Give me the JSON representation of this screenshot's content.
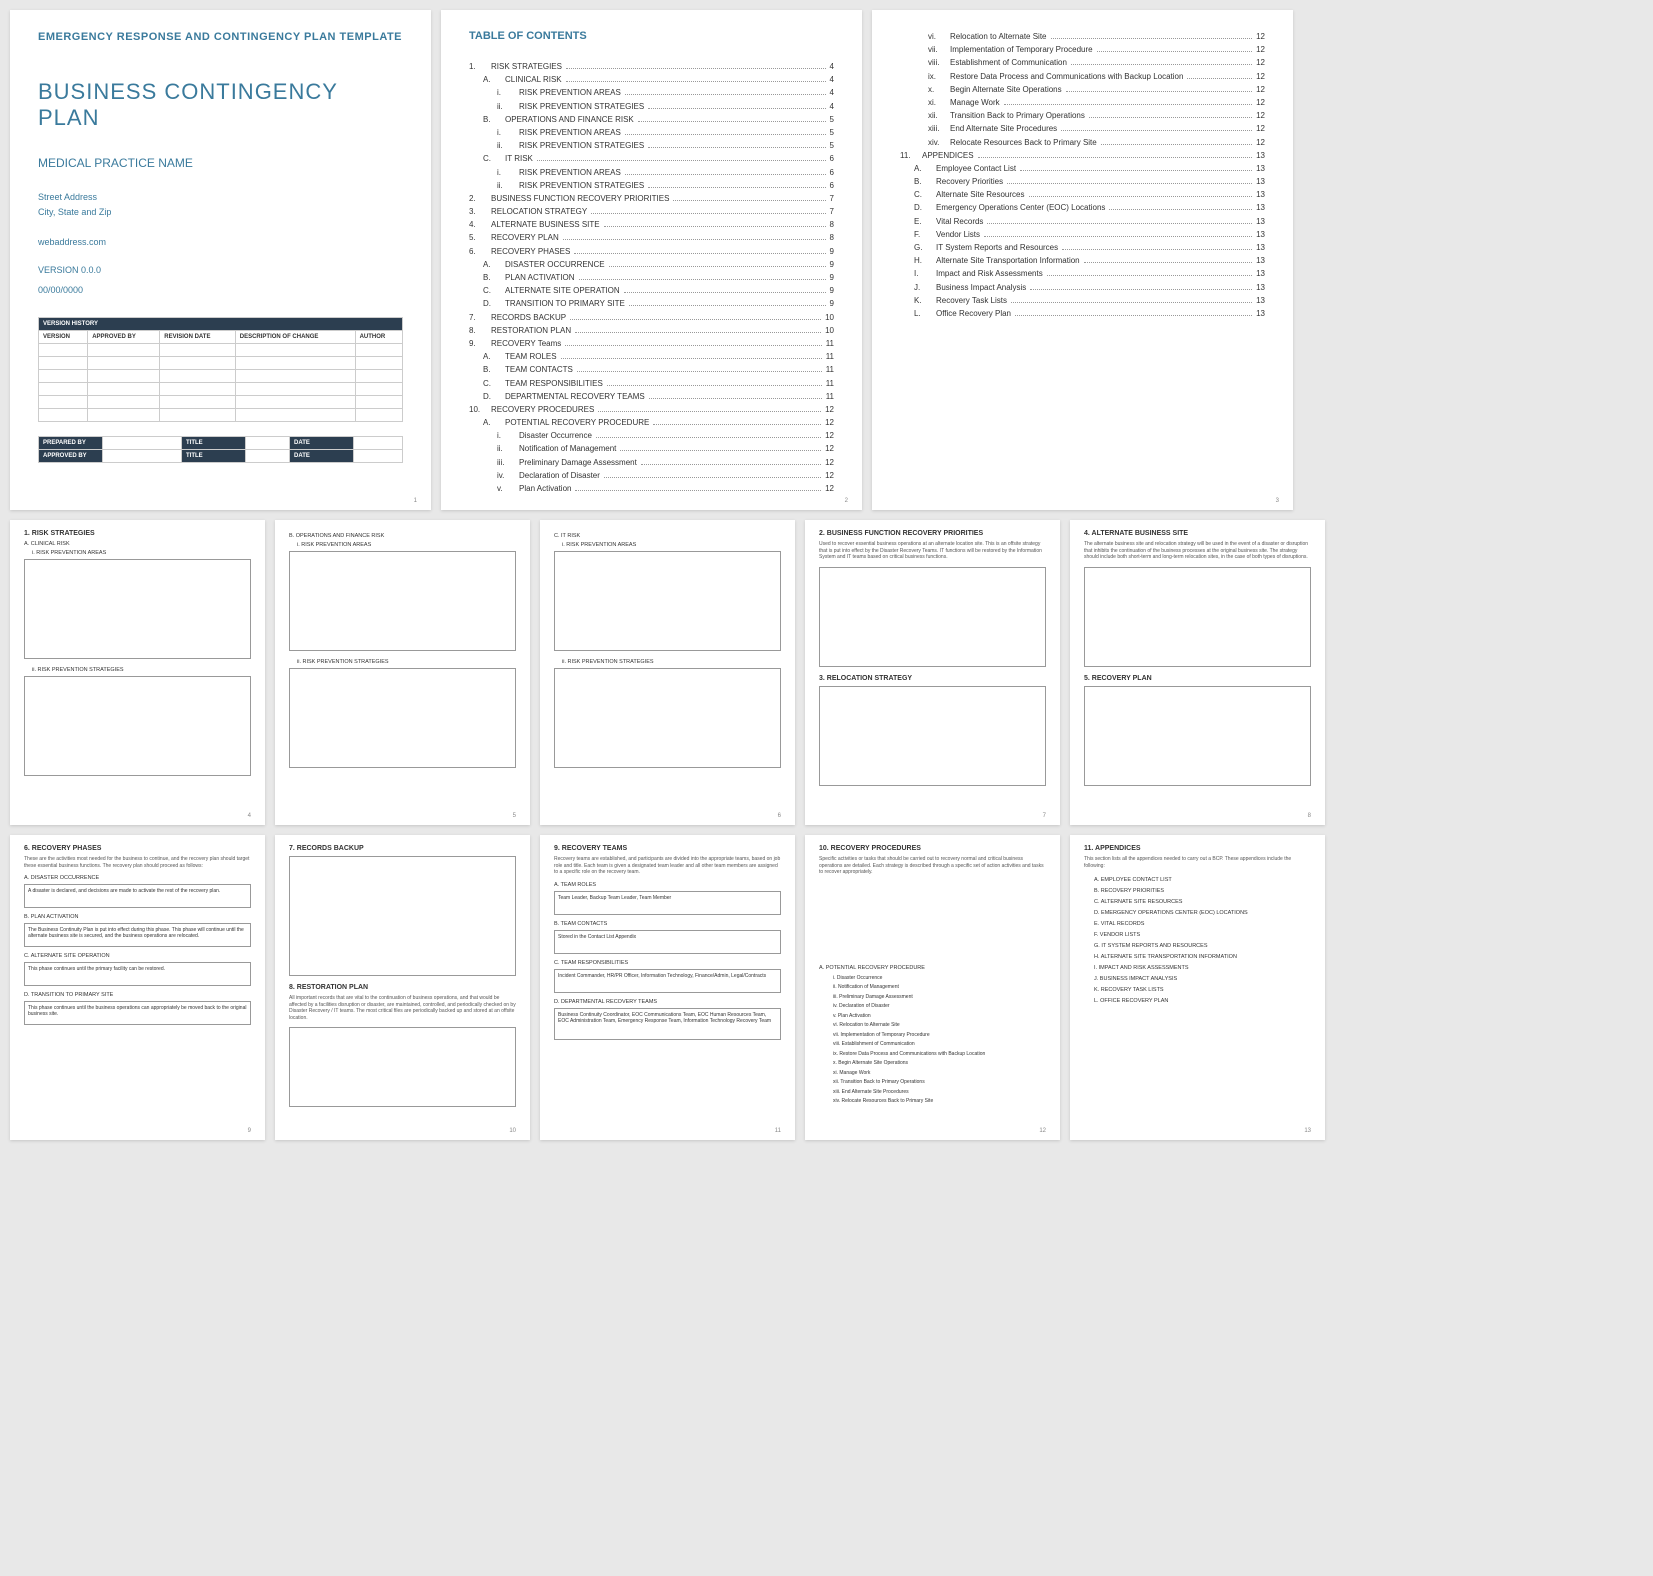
{
  "p1": {
    "hdr": "EMERGENCY RESPONSE AND CONTINGENCY PLAN TEMPLATE",
    "title": "BUSINESS CONTINGENCY PLAN",
    "sub": "MEDICAL PRACTICE NAME",
    "addr1": "Street Address",
    "addr2": "City, State and Zip",
    "web": "webaddress.com",
    "ver": "VERSION 0.0.0",
    "date": "00/00/0000",
    "vh": "VERSION HISTORY",
    "cols": [
      "VERSION",
      "APPROVED BY",
      "REVISION DATE",
      "DESCRIPTION OF CHANGE",
      "AUTHOR"
    ],
    "ft": [
      "PREPARED BY",
      "TITLE",
      "DATE",
      "APPROVED BY",
      "TITLE",
      "DATE"
    ],
    "pn": "1"
  },
  "p2": {
    "hdr": "TABLE OF CONTENTS",
    "pn": "2",
    "rows": [
      {
        "n": "1.",
        "t": "RISK STRATEGIES",
        "p": "4",
        "i": 0
      },
      {
        "n": "A.",
        "t": "CLINICAL RISK",
        "p": "4",
        "i": 1
      },
      {
        "n": "i.",
        "t": "RISK PREVENTION AREAS",
        "p": "4",
        "i": 2
      },
      {
        "n": "ii.",
        "t": "RISK PREVENTION STRATEGIES",
        "p": "4",
        "i": 2
      },
      {
        "n": "B.",
        "t": "OPERATIONS AND FINANCE RISK",
        "p": "5",
        "i": 1
      },
      {
        "n": "i.",
        "t": "RISK PREVENTION AREAS",
        "p": "5",
        "i": 2
      },
      {
        "n": "ii.",
        "t": "RISK PREVENTION STRATEGIES",
        "p": "5",
        "i": 2
      },
      {
        "n": "C.",
        "t": "IT RISK",
        "p": "6",
        "i": 1
      },
      {
        "n": "i.",
        "t": "RISK PREVENTION AREAS",
        "p": "6",
        "i": 2
      },
      {
        "n": "ii.",
        "t": "RISK PREVENTION STRATEGIES",
        "p": "6",
        "i": 2
      },
      {
        "n": "2.",
        "t": "BUSINESS FUNCTION RECOVERY PRIORITIES",
        "p": "7",
        "i": 0
      },
      {
        "n": "3.",
        "t": "RELOCATION STRATEGY",
        "p": "7",
        "i": 0
      },
      {
        "n": "4.",
        "t": "ALTERNATE BUSINESS SITE",
        "p": "8",
        "i": 0
      },
      {
        "n": "5.",
        "t": "RECOVERY PLAN",
        "p": "8",
        "i": 0
      },
      {
        "n": "6.",
        "t": "RECOVERY PHASES",
        "p": "9",
        "i": 0
      },
      {
        "n": "A.",
        "t": "DISASTER OCCURRENCE",
        "p": "9",
        "i": 1
      },
      {
        "n": "B.",
        "t": "PLAN ACTIVATION",
        "p": "9",
        "i": 1
      },
      {
        "n": "C.",
        "t": "ALTERNATE SITE OPERATION",
        "p": "9",
        "i": 1
      },
      {
        "n": "D.",
        "t": "TRANSITION TO PRIMARY SITE",
        "p": "9",
        "i": 1
      },
      {
        "n": "7.",
        "t": "RECORDS BACKUP",
        "p": "10",
        "i": 0
      },
      {
        "n": "8.",
        "t": "RESTORATION PLAN",
        "p": "10",
        "i": 0
      },
      {
        "n": "9.",
        "t": "RECOVERY Teams",
        "p": "11",
        "i": 0
      },
      {
        "n": "A.",
        "t": "TEAM ROLES",
        "p": "11",
        "i": 1
      },
      {
        "n": "B.",
        "t": "TEAM CONTACTS",
        "p": "11",
        "i": 1
      },
      {
        "n": "C.",
        "t": "TEAM RESPONSIBILITIES",
        "p": "11",
        "i": 1
      },
      {
        "n": "D.",
        "t": "DEPARTMENTAL RECOVERY TEAMS",
        "p": "11",
        "i": 1
      },
      {
        "n": "10.",
        "t": "RECOVERY PROCEDURES",
        "p": "12",
        "i": 0
      },
      {
        "n": "A.",
        "t": "POTENTIAL RECOVERY PROCEDURE",
        "p": "12",
        "i": 1
      },
      {
        "n": "i.",
        "t": "Disaster Occurrence",
        "p": "12",
        "i": 2
      },
      {
        "n": "ii.",
        "t": "Notification of Management",
        "p": "12",
        "i": 2
      },
      {
        "n": "iii.",
        "t": "Preliminary Damage Assessment",
        "p": "12",
        "i": 2
      },
      {
        "n": "iv.",
        "t": "Declaration of Disaster",
        "p": "12",
        "i": 2
      },
      {
        "n": "v.",
        "t": "Plan Activation",
        "p": "12",
        "i": 2
      }
    ]
  },
  "p3": {
    "pn": "3",
    "rows": [
      {
        "n": "vi.",
        "t": "Relocation to Alternate Site",
        "p": "12",
        "i": 2
      },
      {
        "n": "vii.",
        "t": "Implementation of Temporary Procedure",
        "p": "12",
        "i": 2
      },
      {
        "n": "viii.",
        "t": "Establishment of Communication",
        "p": "12",
        "i": 2
      },
      {
        "n": "ix.",
        "t": "Restore Data Process and Communications with Backup Location",
        "p": "12",
        "i": 2
      },
      {
        "n": "x.",
        "t": "Begin Alternate Site Operations",
        "p": "12",
        "i": 2
      },
      {
        "n": "xi.",
        "t": "Manage Work",
        "p": "12",
        "i": 2
      },
      {
        "n": "xii.",
        "t": "Transition Back to Primary Operations",
        "p": "12",
        "i": 2
      },
      {
        "n": "xiii.",
        "t": "End Alternate Site Procedures",
        "p": "12",
        "i": 2
      },
      {
        "n": "xiv.",
        "t": "Relocate Resources Back to Primary Site",
        "p": "12",
        "i": 2
      },
      {
        "n": "11.",
        "t": "APPENDICES",
        "p": "13",
        "i": 0
      },
      {
        "n": "A.",
        "t": "Employee Contact List",
        "p": "13",
        "i": 1
      },
      {
        "n": "B.",
        "t": "Recovery Priorities",
        "p": "13",
        "i": 1
      },
      {
        "n": "C.",
        "t": "Alternate Site Resources",
        "p": "13",
        "i": 1
      },
      {
        "n": "D.",
        "t": "Emergency Operations Center (EOC) Locations",
        "p": "13",
        "i": 1
      },
      {
        "n": "E.",
        "t": "Vital Records",
        "p": "13",
        "i": 1
      },
      {
        "n": "F.",
        "t": "Vendor Lists",
        "p": "13",
        "i": 1
      },
      {
        "n": "G.",
        "t": "IT System Reports and Resources",
        "p": "13",
        "i": 1
      },
      {
        "n": "H.",
        "t": "Alternate Site Transportation Information",
        "p": "13",
        "i": 1
      },
      {
        "n": "I.",
        "t": "Impact and Risk Assessments",
        "p": "13",
        "i": 1
      },
      {
        "n": "J.",
        "t": "Business Impact Analysis",
        "p": "13",
        "i": 1
      },
      {
        "n": "K.",
        "t": "Recovery Task Lists",
        "p": "13",
        "i": 1
      },
      {
        "n": "L.",
        "t": "Office Recovery Plan",
        "p": "13",
        "i": 1
      }
    ]
  },
  "p4": {
    "h": "1. RISK STRATEGIES",
    "a": "A. CLINICAL RISK",
    "i": "i. RISK PREVENTION AREAS",
    "ii": "ii. RISK PREVENTION STRATEGIES",
    "pn": "4"
  },
  "p5": {
    "a": "B. OPERATIONS AND FINANCE RISK",
    "i": "i. RISK PREVENTION AREAS",
    "ii": "ii. RISK PREVENTION STRATEGIES",
    "pn": "5"
  },
  "p6": {
    "a": "C. IT RISK",
    "i": "i. RISK PREVENTION AREAS",
    "ii": "ii. RISK PREVENTION STRATEGIES",
    "pn": "6"
  },
  "p7": {
    "h1": "2. BUSINESS FUNCTION RECOVERY PRIORITIES",
    "b1": "Used to recover essential business operations at an alternate location site. This is an offsite strategy that is put into effect by the Disaster Recovery Teams. IT functions will be restored by the Information System and IT teams based on critical business functions.",
    "h2": "3. RELOCATION STRATEGY",
    "pn": "7"
  },
  "p8": {
    "h1": "4. ALTERNATE BUSINESS SITE",
    "b1": "The alternate business site and relocation strategy will be used in the event of a disaster or disruption that inhibits the continuation of the business processes at the original business site. The strategy should include both short-term and long-term relocation sites, in the case of both types of disruptions.",
    "h2": "5. RECOVERY PLAN",
    "pn": "8"
  },
  "p9": {
    "h": "6. RECOVERY PHASES",
    "b": "These are the activities most needed for the business to continue, and the recovery plan should target these essential business functions. The recovery plan should proceed as follows:",
    "a": "A. DISASTER OCCURRENCE",
    "at": "A disaster is declared, and decisions are made to activate the rest of the recovery plan.",
    "bb": "B. PLAN ACTIVATION",
    "bt": "The Business Continuity Plan is put into effect during this phase. This phase will continue until the alternate business site is secured, and the business operations are relocated.",
    "c": "C. ALTERNATE SITE OPERATION",
    "ct": "This phase continues until the primary facility can be restored.",
    "d": "D. TRANSITION TO PRIMARY SITE",
    "dt": "This phase continues until the business operations can appropriately be moved back to the original business site.",
    "pn": "9"
  },
  "p10": {
    "h1": "7. RECORDS BACKUP",
    "h2": "8. RESTORATION PLAN",
    "b2": "All important records that are vital to the continuation of business operations, and that would be affected by a facilities disruption or disaster, are maintained, controlled, and periodically checked on by Disaster Recovery / IT teams. The most critical files are periodically backed up and stored at an offsite location.",
    "pn": "10"
  },
  "p11": {
    "h": "9. RECOVERY TEAMS",
    "b": "Recovery teams are established, and participants are divided into the appropriate teams, based on job role and title. Each team is given a designated team leader and all other team members are assigned to a specific role on the recovery team.",
    "a": "A. TEAM ROLES",
    "at": "Team Leader, Backup Team Leader, Team Member",
    "bb": "B. TEAM CONTACTS",
    "bt": "Stored in the Contact List Appendix",
    "c": "C. TEAM RESPONSIBILITIES",
    "ct": "Incident Commander, HR/PR Officer, Information Technology, Finance/Admin, Legal/Contracts",
    "d": "D. DEPARTMENTAL RECOVERY TEAMS",
    "dt": "Business Continuity Coordinator, EOC Communications Team, EOC Human Resources Team, EOC Administration Team, Emergency Response Team, Information Technology Recovery Team",
    "pn": "11"
  },
  "p12": {
    "h": "10. RECOVERY PROCEDURES",
    "b": "Specific activities or tasks that should be carried out to recovery normal and critical business operations are detailed. Each strategy is described through a specific set of action activities and tasks to recover appropriately.",
    "a": "A. POTENTIAL RECOVERY PROCEDURE",
    "items": [
      "i. Disaster Occurrence",
      "ii. Notification of Management",
      "iii. Preliminary Damage Assessment",
      "iv. Declaration of Disaster",
      "v. Plan Activation",
      "vi. Relocation to Alternate Site",
      "vii. Implementation of Temporary Procedure",
      "viii. Establishment of Communication",
      "ix. Restore Data Process and Communications with Backup Location",
      "x. Begin Alternate Site Operations",
      "xi. Manage Work",
      "xii. Transition Back to Primary Operations",
      "xiii. End Alternate Site Procedures",
      "xiv. Relocate Resources Back to Primary Site"
    ],
    "pn": "12"
  },
  "p13": {
    "h": "11. APPENDICES",
    "b": "This section lists all the appendices needed to carry out a BCP. These appendices include the following:",
    "items": [
      "A. EMPLOYEE CONTACT LIST",
      "B. RECOVERY PRIORITIES",
      "C. ALTERNATE SITE RESOURCES",
      "D. EMERGENCY OPERATIONS CENTER (EOC) LOCATIONS",
      "E. VITAL RECORDS",
      "F. VENDOR LISTS",
      "G. IT SYSTEM REPORTS AND RESOURCES",
      "H. ALTERNATE SITE TRANSPORTATION INFORMATION",
      "I. IMPACT AND RISK ASSESSMENTS",
      "J. BUSINESS IMPACT ANALYSIS",
      "K. RECOVERY TASK LISTS",
      "L. OFFICE RECOVERY PLAN"
    ],
    "pn": "13"
  }
}
